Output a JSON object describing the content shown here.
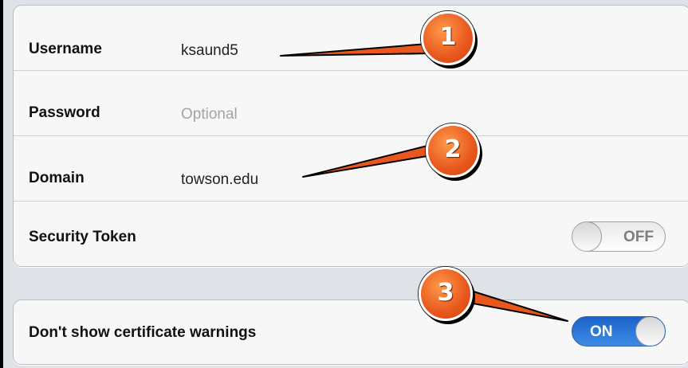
{
  "form": {
    "username": {
      "label": "Username",
      "value": "ksaund5"
    },
    "password": {
      "label": "Password",
      "placeholder": "Optional"
    },
    "domain": {
      "label": "Domain",
      "value": "towson.edu"
    },
    "security_token": {
      "label": "Security Token",
      "switch_text": "OFF",
      "state": "off"
    }
  },
  "advanced": {
    "certificate_warnings": {
      "label": "Don't show certificate warnings",
      "switch_text": "ON",
      "state": "on"
    }
  },
  "annotations": {
    "marker_1": "1",
    "marker_2": "2",
    "marker_3": "3"
  },
  "colors": {
    "marker_fill": "#e8571d",
    "switch_on": "#2f7be0",
    "background": "#dfe2e7"
  }
}
